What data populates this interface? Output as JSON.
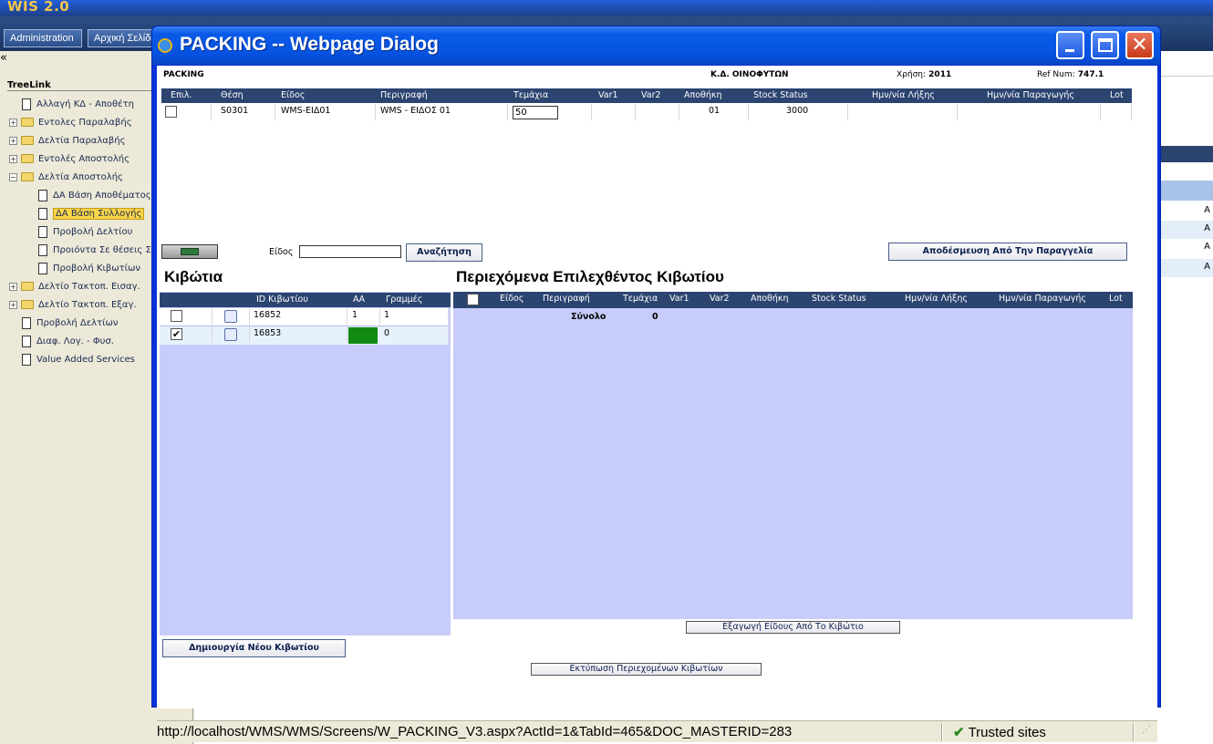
{
  "app": {
    "title": "WIS 2.0",
    "nav": [
      "Administration",
      "Αρχική Σελίδα"
    ],
    "collapse_glyph": "«"
  },
  "sidebar": {
    "title": "TreeLink",
    "items": [
      {
        "label": "Αλλαγή ΚΔ - Αποθέτη",
        "type": "page"
      },
      {
        "label": "Εντολες Παραλαβής",
        "type": "folder",
        "expander": "+"
      },
      {
        "label": "Δελτία Παραλαβής",
        "type": "folder",
        "expander": "+"
      },
      {
        "label": "Εντολές Αποστολής",
        "type": "folder",
        "expander": "+"
      },
      {
        "label": "Δελτία Αποστολής",
        "type": "folder",
        "expander": "−"
      },
      {
        "label": "ΔΑ Βάση Αποθέματος",
        "type": "page"
      },
      {
        "label": "ΔΑ Βάση Συλλογής",
        "type": "page",
        "selected": true
      },
      {
        "label": "Προβολή Δελτίου",
        "type": "page"
      },
      {
        "label": "Προιόντα Σε θέσεις Συλλογής",
        "type": "page"
      },
      {
        "label": "Προβολή Κιβωτίων",
        "type": "page"
      },
      {
        "label": "Δελτίο Τακτοπ. Εισαγ.",
        "type": "folder",
        "expander": "+"
      },
      {
        "label": "Δελτίο Τακτοπ. Εξαγ.",
        "type": "folder",
        "expander": "+"
      },
      {
        "label": "Προβολή Δελτίων",
        "type": "page"
      },
      {
        "label": "Διαφ. Λογ. - Φυσ.",
        "type": "page"
      },
      {
        "label": "Value Added Services",
        "type": "page"
      }
    ]
  },
  "dialog": {
    "title": "PACKING -- Webpage Dialog",
    "header": {
      "form_name": "PACKING",
      "kd": "Κ.Δ. ΟΙΝΟΦΥΤΩΝ",
      "year_label": "Χρήση:",
      "year_value": "2011",
      "ref_label": "Ref Num:",
      "ref_value": "747.1"
    },
    "order_grid": {
      "columns": [
        "Επιλ.",
        "Θέση",
        "Είδος",
        "Περιγραφή",
        "Τεμάχια",
        "Var1",
        "Var2",
        "Αποθήκη",
        "Stock Status",
        "Ημν/νία Λήξης",
        "Ημν/νία Παραγωγής",
        "Lot"
      ],
      "rows": [
        {
          "checked": false,
          "thesi": "S0301",
          "eidos": "WMS-ΕΙΔ01",
          "perigrafi": "WMS - ΕΙΔΟΣ 01",
          "temaxia": "50",
          "var1": "",
          "var2": "",
          "apothiki": "01",
          "stock_status": "3000",
          "lixi": "",
          "paragogi": "",
          "lot": ""
        }
      ]
    },
    "search": {
      "label": "Είδος",
      "value": "",
      "button": "Αναζήτηση"
    },
    "release_button": "Αποδέσμευση Από Την Παραγγελία",
    "boxes": {
      "title": "Κιβώτια",
      "columns": [
        "ID Κιβωτίου",
        "ΑΑ",
        "Γραμμές"
      ],
      "rows": [
        {
          "checked": false,
          "id": "16852",
          "aa": "1",
          "lines": "1"
        },
        {
          "checked": true,
          "id": "16853",
          "aa": "",
          "lines": "0",
          "aa_color": "#138a13"
        }
      ],
      "create_button": "Δημιουργία Νέου Κιβωτίου"
    },
    "contents": {
      "title": "Περιεχόμενα Επιλεχθέντος Κιβωτίου",
      "columns": [
        "Είδος",
        "Περιγραφή",
        "Τεμάχια",
        "Var1",
        "Var2",
        "Αποθήκη",
        "Stock Status",
        "Ημν/νία Λήξης",
        "Ημν/νία Παραγωγής",
        "Lot"
      ],
      "total_label": "Σύνολο",
      "total_value": "0",
      "export_button": "Εξαγωγή Είδους Από Το Κιβώτιο"
    },
    "print_button": "Εκτύπωση Περιεχομένων Κιβωτίων",
    "status": {
      "url": "http://localhost/WMS/WMS/Screens/W_PACKING_V3.aspx?ActId=1&TabId=465&DOC_MASTERID=283",
      "zone": "Trusted sites"
    }
  },
  "background_right": {
    "letters": [
      "Α",
      "Α",
      "Α",
      "Α"
    ]
  },
  "colors": {
    "grid_header": "#2b4470",
    "panel": "#c8ccfa",
    "title_bar": "#0553e0",
    "highlight": "#f9d54a"
  }
}
